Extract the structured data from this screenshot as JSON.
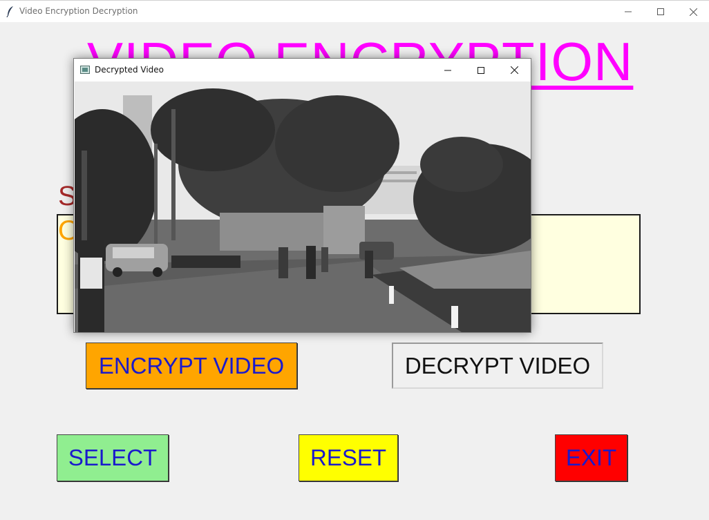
{
  "window": {
    "title": "Video Encryption Decryption"
  },
  "main": {
    "heading": "VIDEO  ENCRYPTION",
    "label_selected": "S",
    "label_output": "O",
    "text_area_value": "",
    "buttons": {
      "encrypt": "ENCRYPT VIDEO",
      "decrypt": "DECRYPT VIDEO",
      "select": "SELECT",
      "reset": "RESET",
      "exit": "EXIT"
    }
  },
  "popup": {
    "title": "Decrypted Video",
    "content": "grayscale-street-scene-video-frame"
  },
  "colors": {
    "heading": "#ff00ff",
    "encrypt_bg": "#ffa500",
    "select_bg": "#90ee90",
    "reset_bg": "#ffff00",
    "exit_bg": "#ff0000",
    "button_text": "#1a1acc",
    "textbox_bg": "#ffffe0"
  },
  "icons": {
    "app": "feather-icon",
    "popup": "video-window-icon",
    "minimize": "minimize-icon",
    "maximize": "maximize-icon",
    "close": "close-icon"
  }
}
